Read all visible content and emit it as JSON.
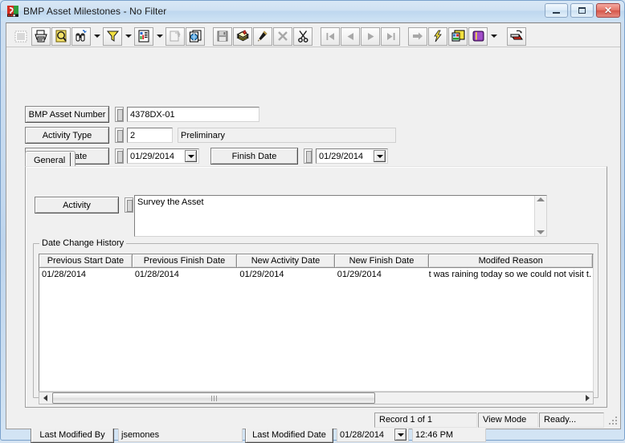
{
  "window": {
    "title": "BMP Asset Milestones - No Filter",
    "app_icon": "bmp-app-icon",
    "controls": {
      "minimize": "minimize-icon",
      "maximize": "maximize-icon",
      "close": "close-icon"
    }
  },
  "toolbar": {
    "buttons": [
      {
        "name": "select-all-icon",
        "glyph": "grid-select",
        "enabled": false,
        "framed": false
      },
      {
        "name": "print-icon",
        "glyph": "printer",
        "enabled": true,
        "framed": true
      },
      {
        "name": "print-preview-icon",
        "glyph": "magnifier-page",
        "enabled": true,
        "framed": true
      },
      {
        "name": "find-icon",
        "glyph": "binoculars",
        "enabled": true,
        "framed": true
      },
      {
        "name": "find-dropdown",
        "glyph": "dropdown",
        "enabled": true,
        "framed": false
      },
      {
        "name": "filter-icon",
        "glyph": "funnel",
        "enabled": true,
        "framed": true
      },
      {
        "name": "filter-dropdown",
        "glyph": "dropdown",
        "enabled": true,
        "framed": false
      },
      {
        "name": "report-icon",
        "glyph": "report",
        "enabled": true,
        "framed": true
      },
      {
        "name": "report-dropdown",
        "glyph": "dropdown",
        "enabled": true,
        "framed": false
      },
      {
        "name": "export-icon",
        "glyph": "page-out",
        "enabled": false,
        "framed": true
      },
      {
        "name": "copy-record-icon",
        "glyph": "pages-globe",
        "enabled": true,
        "framed": true
      },
      {
        "name": "separator-1",
        "glyph": "separator",
        "enabled": true,
        "framed": false
      },
      {
        "name": "save-icon",
        "glyph": "floppy",
        "enabled": false,
        "framed": true
      },
      {
        "name": "new-record-icon",
        "glyph": "cards-plus",
        "enabled": true,
        "framed": true
      },
      {
        "name": "edit-record-icon",
        "glyph": "pencil",
        "enabled": true,
        "framed": true
      },
      {
        "name": "delete-record-icon",
        "glyph": "x-mark",
        "enabled": false,
        "framed": true
      },
      {
        "name": "cut-icon",
        "glyph": "scissors",
        "enabled": true,
        "framed": true
      },
      {
        "name": "separator-2",
        "glyph": "separator",
        "enabled": true,
        "framed": false
      },
      {
        "name": "first-record-icon",
        "glyph": "nav-first",
        "enabled": false,
        "framed": true
      },
      {
        "name": "previous-record-icon",
        "glyph": "nav-prev",
        "enabled": false,
        "framed": true
      },
      {
        "name": "next-record-icon",
        "glyph": "nav-next",
        "enabled": false,
        "framed": true
      },
      {
        "name": "last-record-icon",
        "glyph": "nav-last",
        "enabled": false,
        "framed": true
      },
      {
        "name": "separator-3",
        "glyph": "separator",
        "enabled": true,
        "framed": false
      },
      {
        "name": "goto-icon",
        "glyph": "arrow-right",
        "enabled": false,
        "framed": true
      },
      {
        "name": "action-icon",
        "glyph": "lightning",
        "enabled": true,
        "framed": true
      },
      {
        "name": "layout-icon",
        "glyph": "window-layout",
        "enabled": true,
        "framed": true
      },
      {
        "name": "help-book-icon",
        "glyph": "book",
        "enabled": true,
        "framed": true
      },
      {
        "name": "help-dropdown",
        "glyph": "dropdown",
        "enabled": true,
        "framed": false
      },
      {
        "name": "separator-4",
        "glyph": "separator",
        "enabled": true,
        "framed": false
      },
      {
        "name": "close-window-icon",
        "glyph": "close-doc",
        "enabled": true,
        "framed": true
      }
    ]
  },
  "form": {
    "fields": [
      {
        "label": "BMP Asset Number",
        "value": "4378DX-01"
      },
      {
        "label": "Activity Type",
        "value": "2",
        "description": "Preliminary"
      },
      {
        "label": "Start Date",
        "value": "01/29/2014"
      },
      {
        "label": "Finish Date",
        "value": "01/29/2014"
      }
    ]
  },
  "tabs": [
    {
      "label": "General",
      "selected": true
    }
  ],
  "general_tab": {
    "activity": {
      "label": "Activity",
      "value": "Survey the Asset"
    },
    "group": {
      "title": "Date Change History",
      "columns": [
        "Previous Start Date",
        "Previous Finish Date",
        "New Activity Date",
        "New Finish Date",
        "Modifed Reason"
      ],
      "rows": [
        [
          "01/28/2014",
          "01/28/2014",
          "01/29/2014",
          "01/29/2014",
          "It was raining today so we could not visit t."
        ]
      ]
    }
  },
  "footer": {
    "last_modified_by": {
      "label": "Last Modified By",
      "value": "jsemones"
    },
    "last_modified_date": {
      "label": "Last Modified Date",
      "date": "01/28/2014",
      "time": "12:46 PM"
    }
  },
  "statusbar": {
    "record": "Record 1 of 1",
    "mode": "View Mode",
    "state": "Ready..."
  }
}
